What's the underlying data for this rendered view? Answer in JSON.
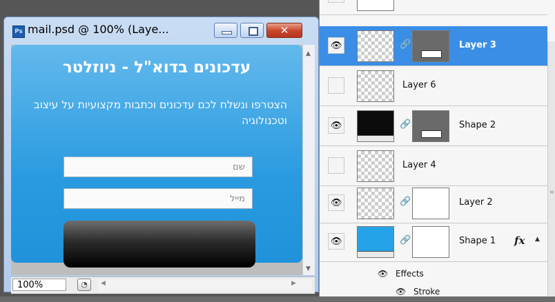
{
  "document": {
    "title": "mail.psd @ 100% (Laye...",
    "app_icon": "Ps",
    "window_controls": {
      "minimize": "minimize-icon",
      "maximize": "maximize-icon",
      "close": "close-icon"
    },
    "zoom": "100%"
  },
  "newsletter": {
    "title": "עדכונים בדוא\"ל - ניוזלטר",
    "description": "הצטרפו ונשלח לכם עדכונים וכתבות מקצועיות על עיצוב וטכנולוגיה",
    "name_placeholder": "שם",
    "email_placeholder": "מייל",
    "accent_color": "#2a9be0"
  },
  "layers": [
    {
      "name": "Layer 3",
      "visible": true,
      "selected": true,
      "thumb": "checker",
      "mask": "gray-bar",
      "linked": true
    },
    {
      "name": "Layer 6",
      "visible": false,
      "selected": false,
      "thumb": "checker",
      "mask": null,
      "linked": false
    },
    {
      "name": "Shape 2",
      "visible": true,
      "selected": false,
      "thumb": "black-vector",
      "mask": "gray-bar",
      "linked": true
    },
    {
      "name": "Layer 4",
      "visible": false,
      "selected": false,
      "thumb": "checker",
      "mask": null,
      "linked": false
    },
    {
      "name": "Layer 2",
      "visible": true,
      "selected": false,
      "thumb": "checker-light",
      "mask": "white",
      "linked": true
    },
    {
      "name": "Shape 1",
      "visible": true,
      "selected": false,
      "thumb": "blue-vector",
      "mask": "white",
      "linked": true,
      "fx": "fx"
    }
  ],
  "effects": {
    "label": "Effects",
    "stroke": "Stroke"
  },
  "selection_color": "#3a8ee6"
}
